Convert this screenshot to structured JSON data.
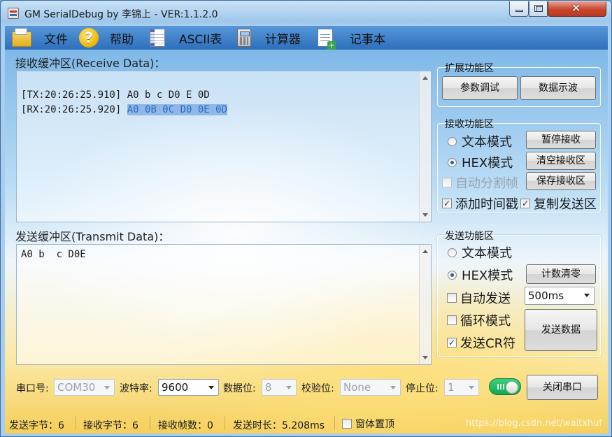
{
  "window": {
    "title": "GM SerialDebug by 李锦上 - VER:1.1.2.0"
  },
  "menu": {
    "file": "文件",
    "help": "帮助",
    "ascii": "ASCII表",
    "calculator": "计算器",
    "notepad": "记事本"
  },
  "receive": {
    "label": "接收缓冲区(Receive Data)：",
    "lines": [
      {
        "prefix": "[TX:20:26:25.910]",
        "data": "A0 b c D0 E 0D"
      },
      {
        "prefix": "[RX:20:26:25.920]",
        "data": "A0 0B 0C D0 0E 0D"
      }
    ]
  },
  "transmit": {
    "label": "发送缓冲区(Transmit Data)：",
    "content": "A0 b  c D0E"
  },
  "ext_group": {
    "title": "扩展功能区",
    "param_debug": "参数调试",
    "data_scope": "数据示波"
  },
  "recv_group": {
    "title": "接收功能区",
    "text_mode": "文本模式",
    "hex_mode": "HEX模式",
    "pause": "暂停接收",
    "clear": "清空接收区",
    "auto_split": "自动分割帧",
    "save": "保存接收区",
    "add_timestamp": "添加时间戳",
    "copy_send": "复制发送区",
    "check_mark": "✓"
  },
  "send_group": {
    "title": "发送功能区",
    "text_mode": "文本模式",
    "hex_mode": "HEX模式",
    "count_clear": "计数清零",
    "auto_send": "自动发送",
    "interval": "500ms",
    "loop_mode": "循环模式",
    "send_data": "发送数据",
    "send_cr": "发送CR符",
    "check_mark": "✓"
  },
  "serial": {
    "port_label": "串口号:",
    "port_value": "COM30",
    "baud_label": "波特率:",
    "baud_value": "9600",
    "data_bits_label": "数据位:",
    "data_bits_value": "8",
    "parity_label": "校验位:",
    "parity_value": "None",
    "stop_bits_label": "停止位:",
    "stop_bits_value": "1",
    "close_port": "关闭串口"
  },
  "status": {
    "sent_bytes": "发送字节：6",
    "recv_bytes": "接收字节：6",
    "recv_frames": "接收帧数：0",
    "send_duration": "发送时长：5.208ms",
    "on_top": "窗体置顶"
  },
  "watermark": "https://blog.csdn.net/waitxhuf"
}
